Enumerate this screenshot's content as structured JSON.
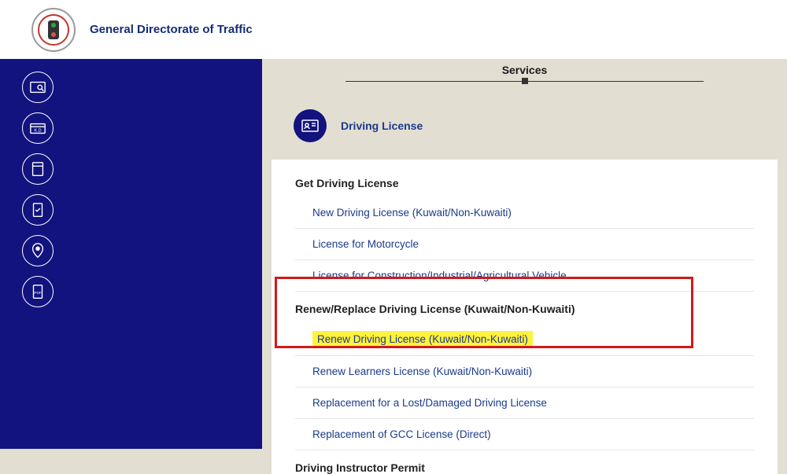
{
  "header": {
    "title": "General Directorate of Traffic"
  },
  "services": {
    "title": "Services",
    "category_label": "Driving License"
  },
  "sections": {
    "get_driving_license": {
      "header": "Get Driving License",
      "items": {
        "new_license": "New Driving License (Kuwait/Non-Kuwaiti)",
        "motorcycle": "License for Motorcycle",
        "construction": "License for Construction/Industrial/Agricultural Vehicle"
      }
    },
    "renew_replace": {
      "header": "Renew/Replace Driving License (Kuwait/Non-Kuwaiti)",
      "items": {
        "renew": "Renew Driving License (Kuwait/Non-Kuwaiti)",
        "renew_learners": "Renew Learners License (Kuwait/Non-Kuwaiti)",
        "replace_lost": "Replacement for a Lost/Damaged Driving License",
        "replace_gcc": "Replacement of GCC License (Direct)"
      }
    },
    "instructor": {
      "header": "Driving Instructor Permit"
    }
  }
}
